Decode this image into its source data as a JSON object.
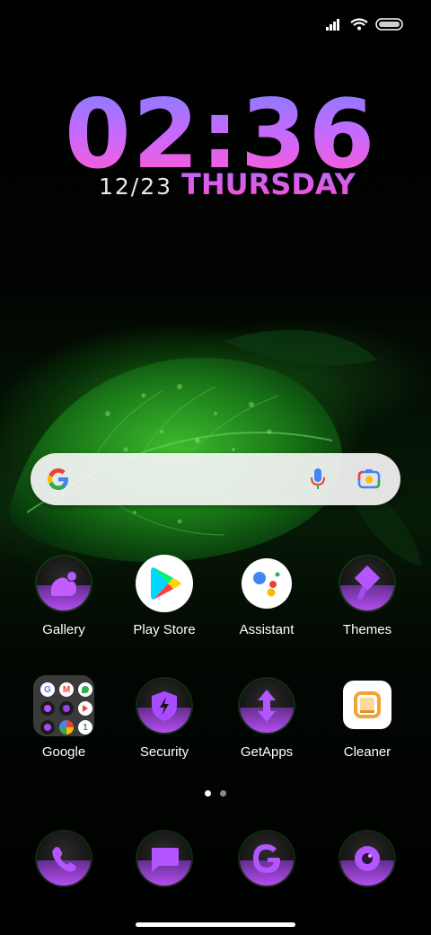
{
  "clock": {
    "time": "02:36",
    "date": "12/23",
    "weekday": "THURSDAY"
  },
  "search": {
    "provider_icon": "google-g-icon",
    "mic_icon": "mic-icon",
    "lens_icon": "lens-icon"
  },
  "apps_row1": [
    {
      "label": "Gallery",
      "icon": "gallery-icon"
    },
    {
      "label": "Play Store",
      "icon": "play-store-icon"
    },
    {
      "label": "Assistant",
      "icon": "assistant-icon"
    },
    {
      "label": "Themes",
      "icon": "themes-icon"
    }
  ],
  "apps_row2": [
    {
      "label": "Google",
      "icon": "google-folder-icon"
    },
    {
      "label": "Security",
      "icon": "security-icon"
    },
    {
      "label": "GetApps",
      "icon": "getapps-icon"
    },
    {
      "label": "Cleaner",
      "icon": "cleaner-icon"
    }
  ],
  "dock": [
    {
      "icon": "phone-icon"
    },
    {
      "icon": "messages-icon"
    },
    {
      "icon": "google-browser-icon"
    },
    {
      "icon": "camera-icon"
    }
  ],
  "pages": {
    "count": 2,
    "current": 1
  },
  "colors": {
    "clock_gradient_top": "#8a7cff",
    "clock_gradient_bottom": "#ff5ad6",
    "icon_accent": "#b44cff"
  }
}
